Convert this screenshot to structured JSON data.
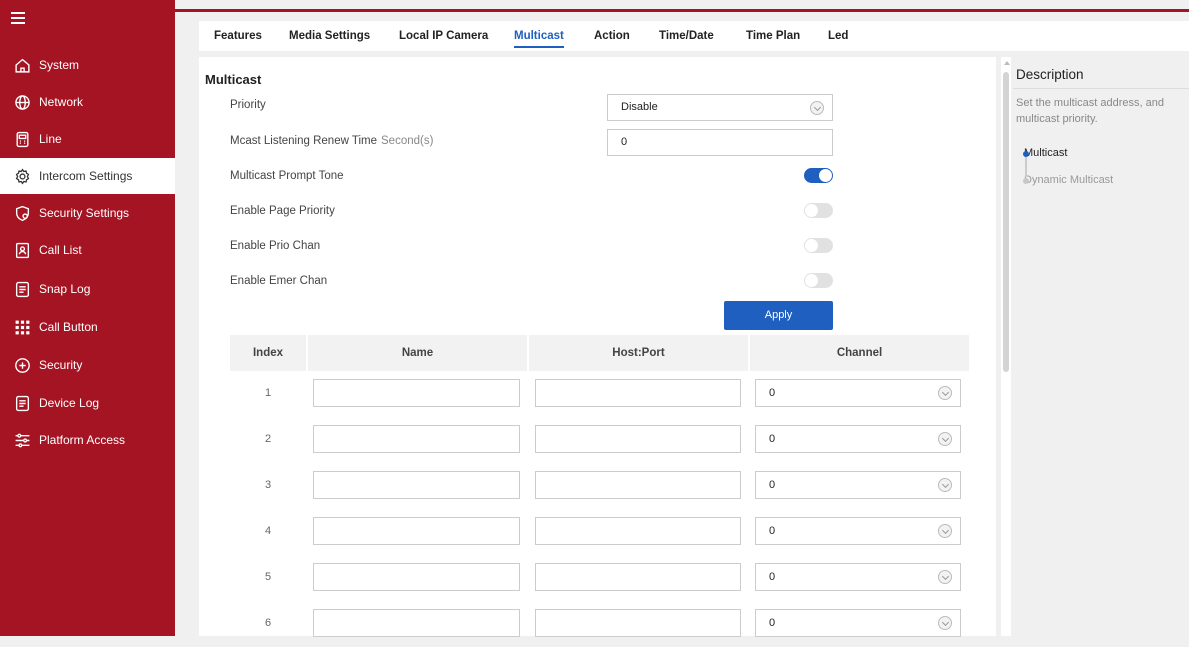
{
  "sidebar": {
    "items": [
      {
        "label": "System",
        "icon": "home-icon"
      },
      {
        "label": "Network",
        "icon": "globe-icon"
      },
      {
        "label": "Line",
        "icon": "phone-box-icon"
      },
      {
        "label": "Intercom Settings",
        "icon": "gear-icon"
      },
      {
        "label": "Security Settings",
        "icon": "shield-icon"
      },
      {
        "label": "Call List",
        "icon": "contact-card-icon"
      },
      {
        "label": "Snap Log",
        "icon": "document-icon"
      },
      {
        "label": "Call Button",
        "icon": "grid-icon"
      },
      {
        "label": "Security",
        "icon": "plus-shield-icon"
      },
      {
        "label": "Device Log",
        "icon": "document-icon"
      },
      {
        "label": "Platform Access",
        "icon": "sliders-icon"
      }
    ],
    "active_index": 3
  },
  "tabs": [
    {
      "label": "Features"
    },
    {
      "label": "Media Settings"
    },
    {
      "label": "Local IP Camera"
    },
    {
      "label": "Multicast"
    },
    {
      "label": "Action"
    },
    {
      "label": "Time/Date"
    },
    {
      "label": "Time Plan"
    },
    {
      "label": "Led"
    }
  ],
  "active_tab_index": 3,
  "main": {
    "title": "Multicast",
    "priority": {
      "label": "Priority",
      "value": "Disable"
    },
    "renew": {
      "label": "Mcast Listening Renew Time",
      "unit": "Second(s)",
      "value": "0"
    },
    "prompt_tone": {
      "label": "Multicast Prompt Tone",
      "on": true
    },
    "page_priority": {
      "label": "Enable Page Priority",
      "on": false
    },
    "prio_chan": {
      "label": "Enable Prio Chan",
      "on": false
    },
    "emer_chan": {
      "label": "Enable Emer Chan",
      "on": false
    },
    "apply_label": "Apply",
    "table": {
      "headers": {
        "index": "Index",
        "name": "Name",
        "host_port": "Host:Port",
        "channel": "Channel"
      },
      "rows": [
        {
          "index": "1",
          "name": "",
          "host_port": "",
          "channel": "0"
        },
        {
          "index": "2",
          "name": "",
          "host_port": "",
          "channel": "0"
        },
        {
          "index": "3",
          "name": "",
          "host_port": "",
          "channel": "0"
        },
        {
          "index": "4",
          "name": "",
          "host_port": "",
          "channel": "0"
        },
        {
          "index": "5",
          "name": "",
          "host_port": "",
          "channel": "0"
        },
        {
          "index": "6",
          "name": "",
          "host_port": "",
          "channel": "0"
        }
      ]
    }
  },
  "description": {
    "title": "Description",
    "text": "Set the multicast address, and multicast priority.",
    "anchors": [
      {
        "label": "Multicast",
        "active": true
      },
      {
        "label": "Dynamic Multicast",
        "active": false
      }
    ]
  },
  "colors": {
    "brand_red": "#a51423",
    "accent_blue": "#1f5fbf"
  }
}
